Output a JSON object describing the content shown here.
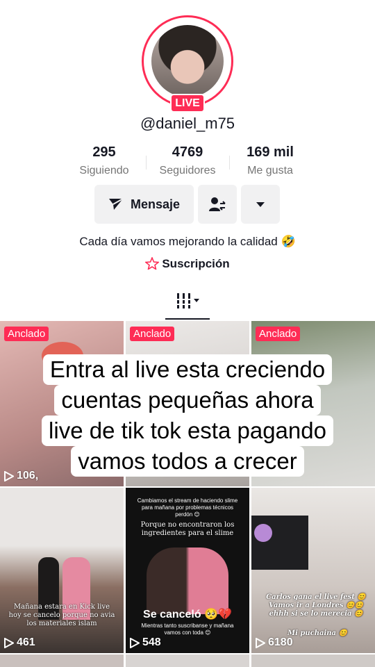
{
  "profile": {
    "username": "@daniel_m75",
    "live_label": "LIVE",
    "bio": "Cada día vamos mejorando la calidad 🤣",
    "subscription_label": "Suscripción"
  },
  "stats": [
    {
      "value": "295",
      "label": "Siguiendo"
    },
    {
      "value": "4769",
      "label": "Seguidores"
    },
    {
      "value": "169 mil",
      "label": "Me gusta"
    }
  ],
  "actions": {
    "message_label": "Mensaje",
    "friend_icon": "add-friend-icon",
    "more_icon": "chevron-down-icon"
  },
  "overlay_lines": [
    "Entra al live esta creciendo",
    "cuentas pequeñas ahora",
    "live de tik tok esta pagando",
    "vamos todos a crecer"
  ],
  "videos": [
    {
      "pinned": "Anclado",
      "views": "106,"
    },
    {
      "pinned": "Anclado",
      "views": ""
    },
    {
      "pinned": "Anclado",
      "views": ""
    },
    {
      "views": "461",
      "caption": "Mañana estara en Kick live hoy se cancelo porque no avia los materiales islam"
    },
    {
      "views": "548",
      "caption_top": "Cambiamos el stream de haciendo slime para mañana por problemas técnicos perdón 😊",
      "caption_mid": "Porque no encontraron los ingredientes para el slime",
      "big": "Se canceló 🥺💔",
      "caption_bottom": "Mientras tanto suscribanse y mañana vamos con toda 😊"
    },
    {
      "views": "6180",
      "caption": "Carlos gana el live fest 😊 Vamos ir a Londres 😊😊 ehhh si se lo merecia 😊",
      "caption2": "Mi puchaina 😊"
    }
  ],
  "colors": {
    "accent": "#fe2c55",
    "text": "#161823",
    "muted": "#757575",
    "button_bg": "#f1f1f2"
  }
}
